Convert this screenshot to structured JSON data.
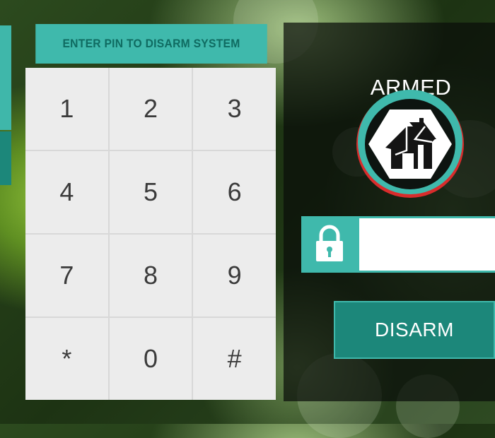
{
  "keypad": {
    "title": "ENTER PIN TO DISARM SYSTEM",
    "keys": [
      "1",
      "2",
      "3",
      "4",
      "5",
      "6",
      "7",
      "8",
      "9",
      "*",
      "0",
      "#"
    ]
  },
  "status": {
    "state": "ARMED",
    "icon": "house-icon"
  },
  "pin_field": {
    "value": "",
    "icon": "lock-icon"
  },
  "actions": {
    "disarm_label": "DISARM"
  },
  "colors": {
    "accent": "#3fb9ac",
    "accent_dark": "#1c877a",
    "key_background": "#ececec",
    "alert_ring": "#d92c2c"
  }
}
